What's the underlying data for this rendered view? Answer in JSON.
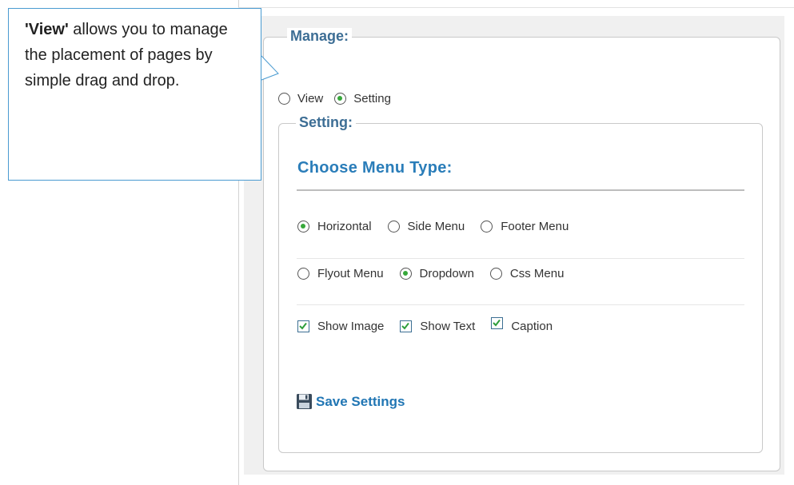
{
  "callout": {
    "bold": "'View'",
    "text": " allows you to manage the placement of pages by simple drag and drop."
  },
  "manage": {
    "legend": "Manage:",
    "options": [
      {
        "label": "View",
        "selected": false
      },
      {
        "label": "Setting",
        "selected": true
      }
    ]
  },
  "setting": {
    "legend": "Setting:",
    "menu_type_title": "Choose Menu Type:",
    "menu_options_row1": [
      {
        "label": "Horizontal",
        "selected": true
      },
      {
        "label": "Side Menu",
        "selected": false
      },
      {
        "label": "Footer Menu",
        "selected": false
      }
    ],
    "menu_options_row2": [
      {
        "label": "Flyout Menu",
        "selected": false
      },
      {
        "label": "Dropdown",
        "selected": true
      },
      {
        "label": "Css Menu",
        "selected": false
      }
    ],
    "checkboxes": [
      {
        "label": "Show Image",
        "checked": true
      },
      {
        "label": "Show Text",
        "checked": true
      },
      {
        "label": "Caption",
        "checked": true
      }
    ],
    "save_label": "Save Settings"
  },
  "colors": {
    "legend": "#3d6e95",
    "title": "#2a7db9",
    "radio_dot": "#37a83a",
    "check": "#2e9e3a",
    "callout_border": "#4a9bd1"
  }
}
